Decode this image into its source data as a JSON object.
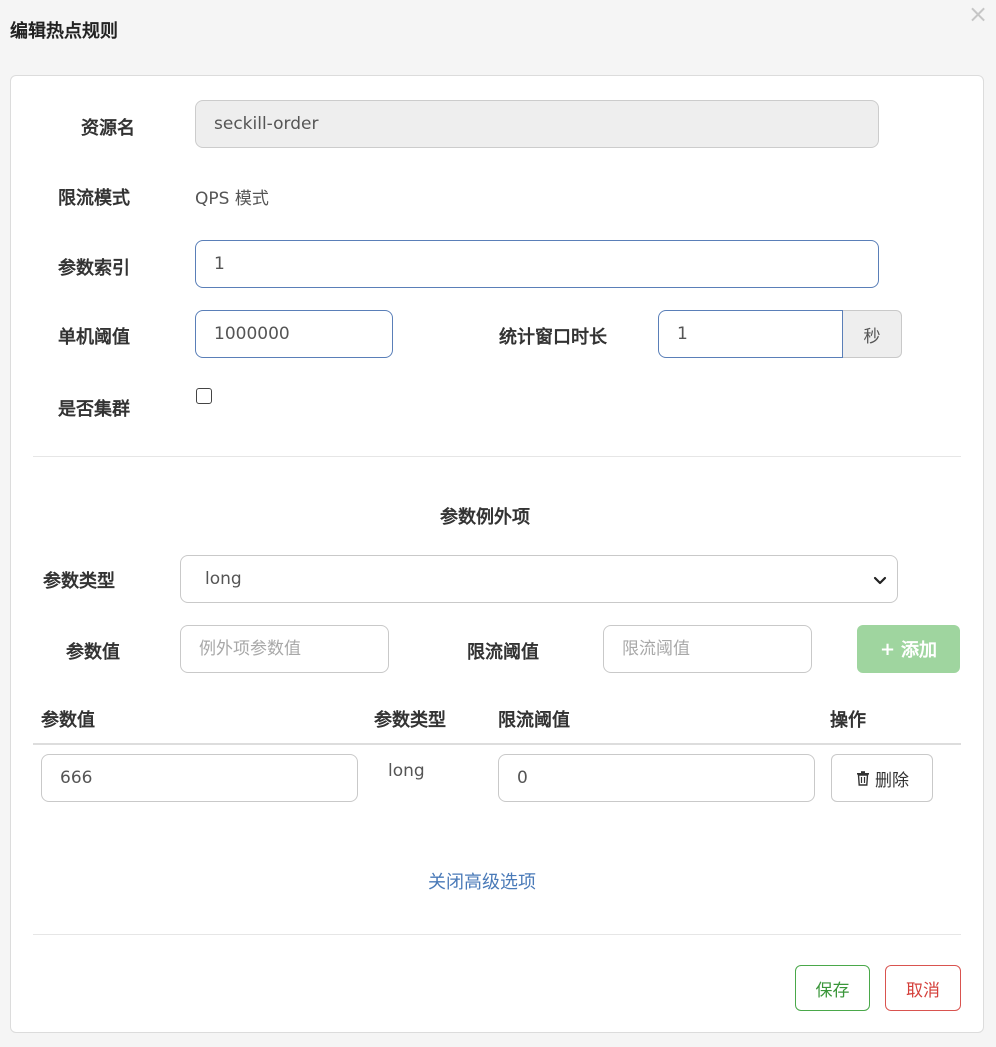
{
  "dialog": {
    "title": "编辑热点规则",
    "close_symbol": "×"
  },
  "form": {
    "resource_name": {
      "label": "资源名",
      "value": "seckill-order"
    },
    "limit_mode": {
      "label": "限流模式",
      "value": "QPS 模式"
    },
    "param_index": {
      "label": "参数索引",
      "value": "1"
    },
    "threshold": {
      "label": "单机阈值",
      "value": "1000000"
    },
    "stat_window": {
      "label": "统计窗口时长",
      "value": "1",
      "unit": "秒"
    },
    "cluster": {
      "label": "是否集群",
      "checked": false
    }
  },
  "exceptions": {
    "section_title": "参数例外项",
    "param_type": {
      "label": "参数类型",
      "selected": "long"
    },
    "param_value": {
      "label": "参数值",
      "placeholder": "例外项参数值"
    },
    "limit_threshold": {
      "label": "限流阈值",
      "placeholder": "限流阈值"
    },
    "add_button": {
      "icon": "+",
      "label": "添加"
    },
    "table": {
      "headers": [
        "参数值",
        "参数类型",
        "限流阈值",
        "操作"
      ],
      "rows": [
        {
          "param_value": "666",
          "param_type": "long",
          "threshold": "0",
          "action_label": "删除"
        }
      ]
    }
  },
  "advanced_link": "关闭高级选项",
  "footer": {
    "save_label": "保存",
    "cancel_label": "取消"
  }
}
